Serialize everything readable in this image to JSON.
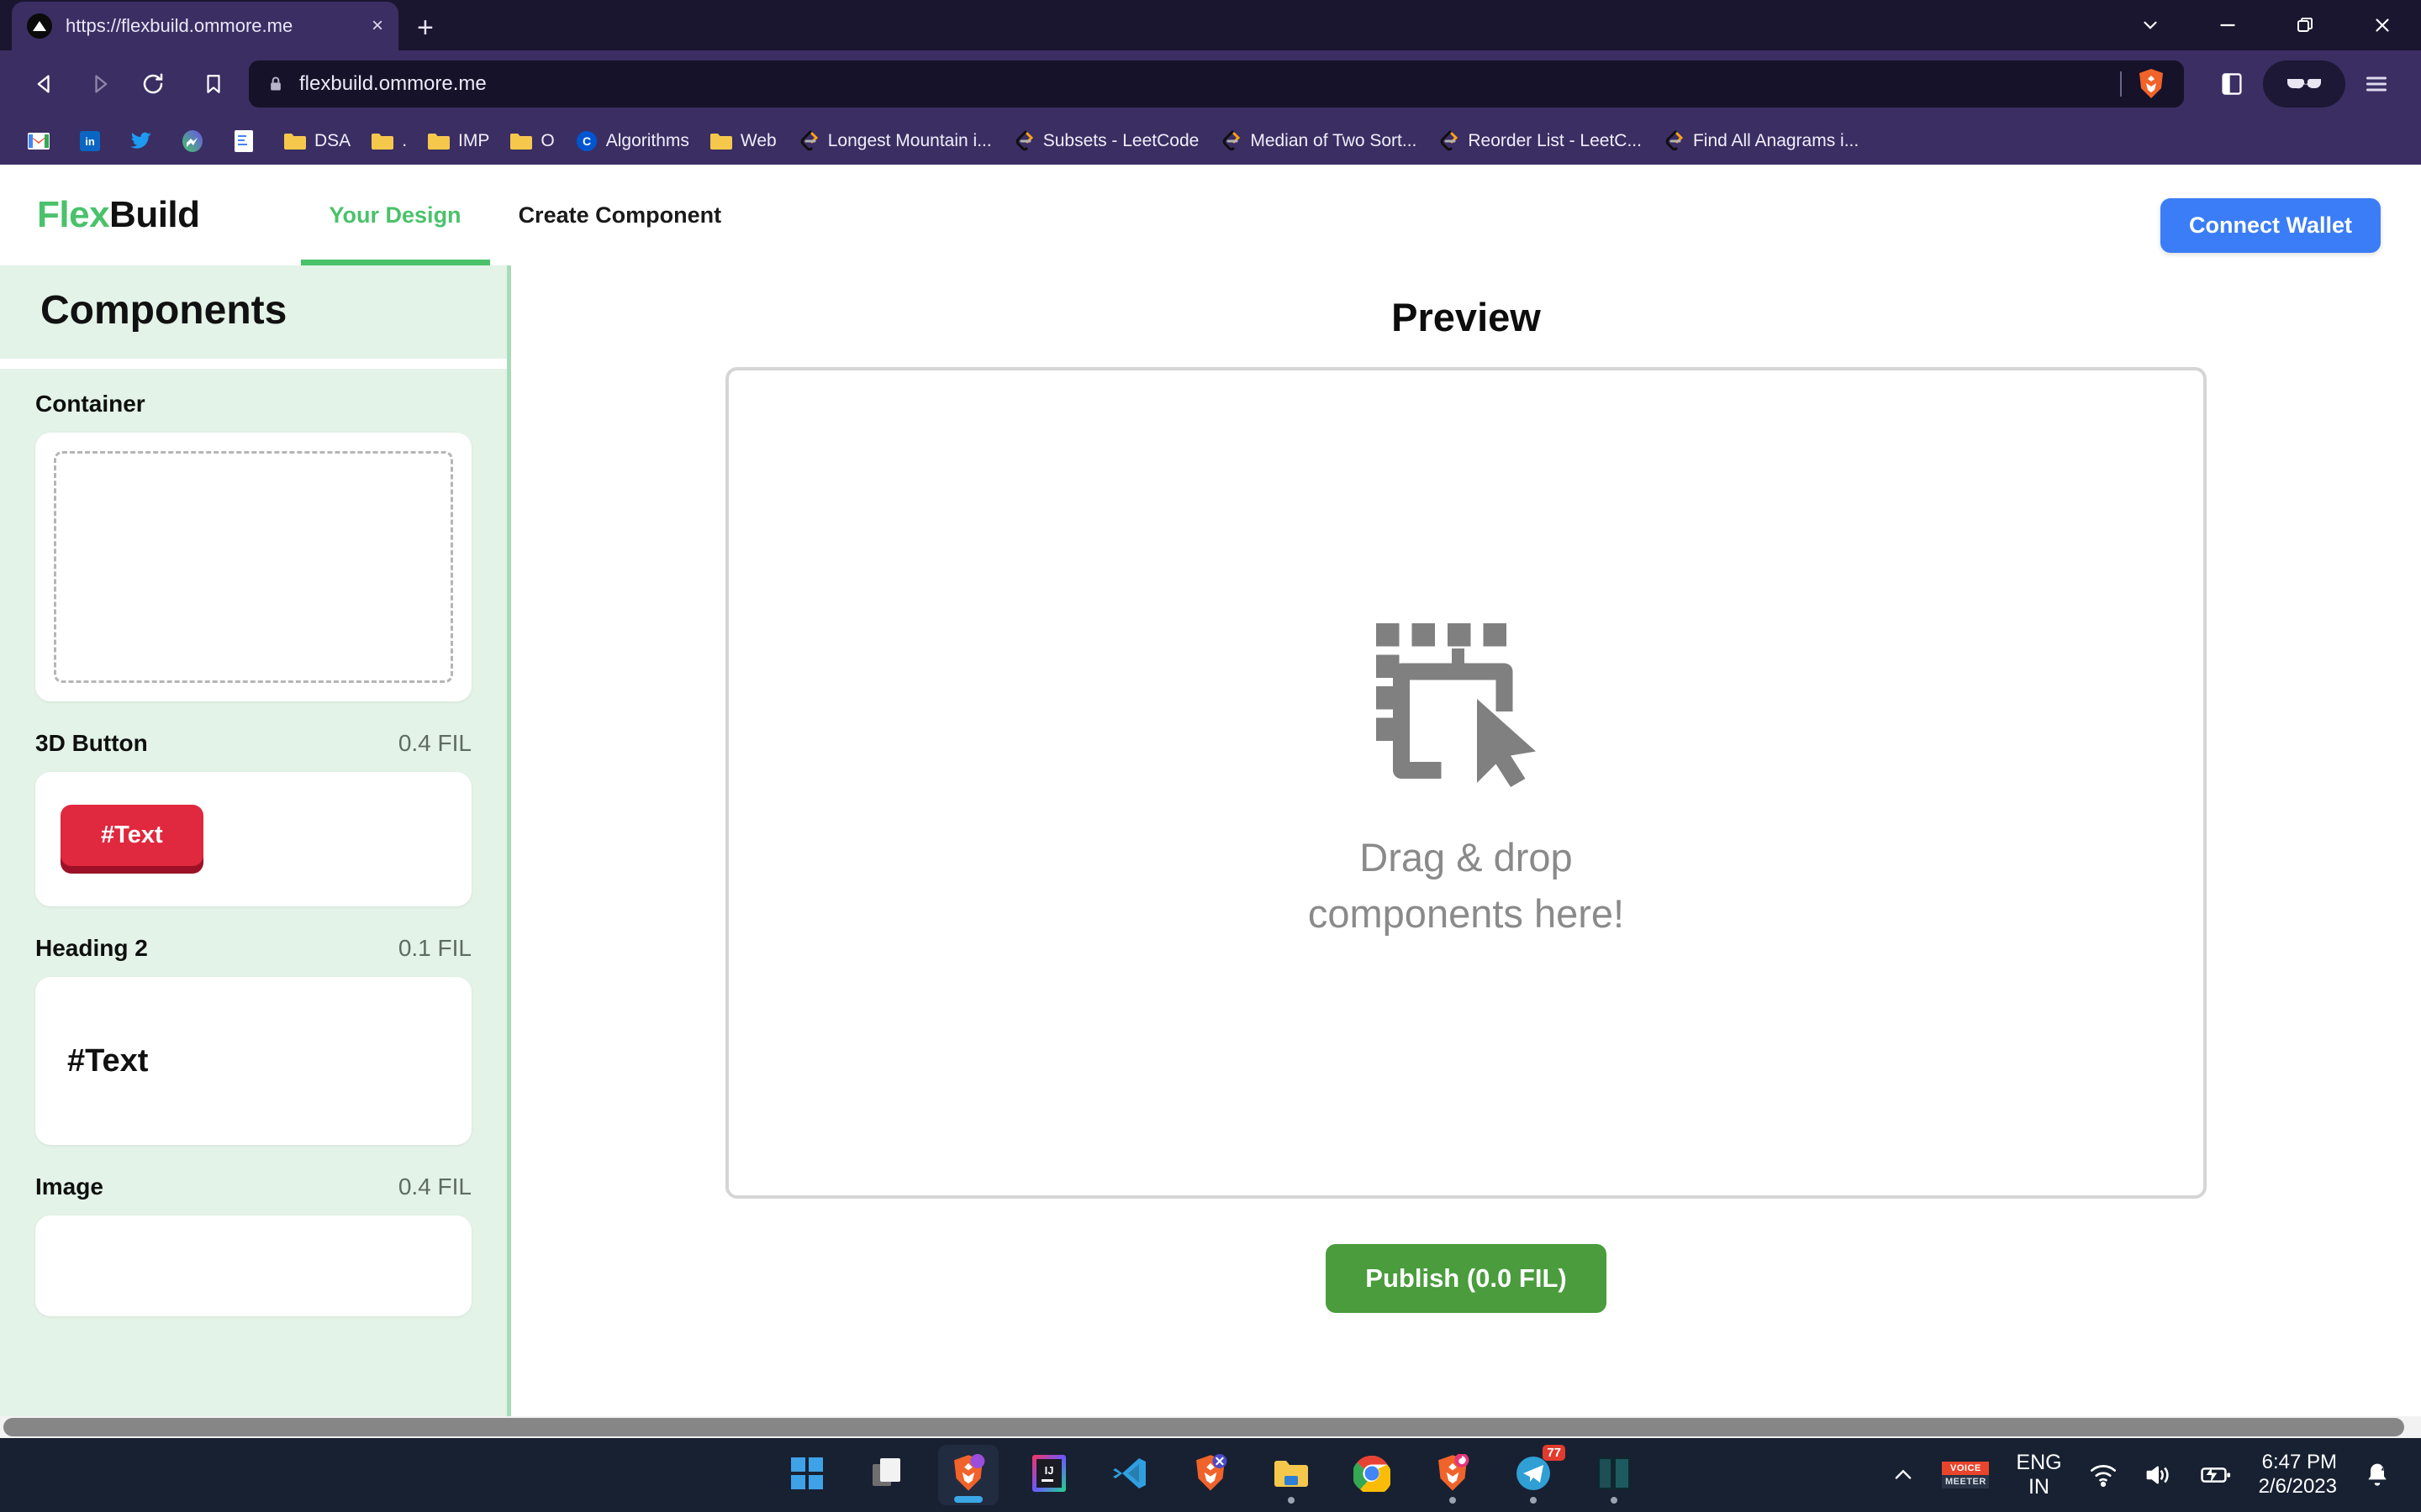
{
  "browser": {
    "tab": {
      "title": "https://flexbuild.ommore.me",
      "favicon": "triangle-favicon",
      "close_label": "×"
    },
    "new_tab_label": "+",
    "window_controls": [
      {
        "name": "tab-search-button",
        "glyph": "chevron-down-icon"
      },
      {
        "name": "minimize-button",
        "glyph": "minimize-icon"
      },
      {
        "name": "restore-button",
        "glyph": "restore-icon"
      },
      {
        "name": "close-window-button",
        "glyph": "close-icon"
      }
    ],
    "omnibox": {
      "url": "flexbuild.ommore.me",
      "lock": "lock-icon",
      "shield": "brave-shield-icon"
    },
    "nav": {
      "back": "back-icon",
      "forward": "forward-icon",
      "reload": "reload-icon",
      "bookmark": "bookmark-icon"
    },
    "toolbar_right": [
      {
        "name": "sidebar-toggle-button",
        "glyph": "panel-icon"
      },
      {
        "name": "private-window-button",
        "glyph": "glasses-icon"
      },
      {
        "name": "browser-menu-button",
        "glyph": "hamburger-icon"
      }
    ],
    "bookmarks": [
      {
        "label": "",
        "icon": "gmail-icon"
      },
      {
        "label": "",
        "icon": "linkedin-icon"
      },
      {
        "label": "",
        "icon": "twitter-icon"
      },
      {
        "label": "",
        "icon": "messenger-icon"
      },
      {
        "label": "",
        "icon": "doc-icon"
      },
      {
        "label": "DSA",
        "icon": "folder-icon"
      },
      {
        "label": ".",
        "icon": "folder-icon"
      },
      {
        "label": "IMP",
        "icon": "folder-icon"
      },
      {
        "label": "O",
        "icon": "folder-icon"
      },
      {
        "label": "Algorithms",
        "icon": "coursera-icon"
      },
      {
        "label": "Web",
        "icon": "folder-icon"
      },
      {
        "label": "Longest Mountain i...",
        "icon": "leetcode-icon"
      },
      {
        "label": "Subsets - LeetCode",
        "icon": "leetcode-icon"
      },
      {
        "label": "Median of Two Sort...",
        "icon": "leetcode-icon"
      },
      {
        "label": "Reorder List - LeetC...",
        "icon": "leetcode-icon"
      },
      {
        "label": "Find All Anagrams i...",
        "icon": "leetcode-icon"
      }
    ]
  },
  "app": {
    "logo": {
      "first": "Flex",
      "second": "Build"
    },
    "tabs": [
      {
        "label": "Your Design",
        "active": true
      },
      {
        "label": "Create Component",
        "active": false
      }
    ],
    "connect_wallet_label": "Connect Wallet",
    "colors": {
      "brand_green": "#4ac26b",
      "wallet_blue": "#3b7df6",
      "publish_green": "#4a9c3d",
      "sidebar_bg": "#e3f3e7",
      "button_red": "#e0283e"
    }
  },
  "sidebar": {
    "title": "Components",
    "components": [
      {
        "name": "Container",
        "price": "",
        "preview": "dashed-box"
      },
      {
        "name": "3D Button",
        "price": "0.4 FIL",
        "preview": "button",
        "sample_text": "#Text"
      },
      {
        "name": "Heading 2",
        "price": "0.1 FIL",
        "preview": "heading",
        "sample_text": "#Text"
      },
      {
        "name": "Image",
        "price": "0.4 FIL",
        "preview": "image"
      }
    ]
  },
  "preview": {
    "title": "Preview",
    "dropzone_icon": "drag-drop-cursor-icon",
    "dropzone_line1": "Drag & drop",
    "dropzone_line2": "components here!",
    "publish_label": "Publish (0.0 FIL)"
  },
  "taskbar": {
    "apps": [
      {
        "name": "start-button",
        "icon": "windows-icon",
        "state": ""
      },
      {
        "name": "task-view-button",
        "icon": "task-view-icon",
        "state": ""
      },
      {
        "name": "taskbar-brave",
        "icon": "brave-icon",
        "state": "active"
      },
      {
        "name": "taskbar-intellij",
        "icon": "intellij-icon",
        "state": ""
      },
      {
        "name": "taskbar-vscode",
        "icon": "vscode-icon",
        "state": ""
      },
      {
        "name": "taskbar-brave-beta",
        "icon": "brave-x-icon",
        "state": ""
      },
      {
        "name": "taskbar-file-explorer",
        "icon": "folder-icon",
        "state": "open"
      },
      {
        "name": "taskbar-chrome",
        "icon": "chrome-icon",
        "state": ""
      },
      {
        "name": "taskbar-brave-nightly",
        "icon": "brave-candy-icon",
        "state": "open"
      },
      {
        "name": "taskbar-telegram",
        "icon": "telegram-icon",
        "state": "open",
        "badge": "77"
      },
      {
        "name": "taskbar-panels",
        "icon": "panels-icon",
        "state": "open"
      }
    ],
    "tray": {
      "overflow": "chevron-up-icon",
      "voicemeeter": {
        "top": "VOICE",
        "bottom": "MEETER"
      },
      "language": {
        "line1": "ENG",
        "line2": "IN"
      },
      "wifi": "wifi-icon",
      "volume": "volume-icon",
      "battery": "battery-charging-icon",
      "time": "6:47 PM",
      "date": "2/6/2023",
      "notifications": "bell-dnd-icon"
    }
  }
}
